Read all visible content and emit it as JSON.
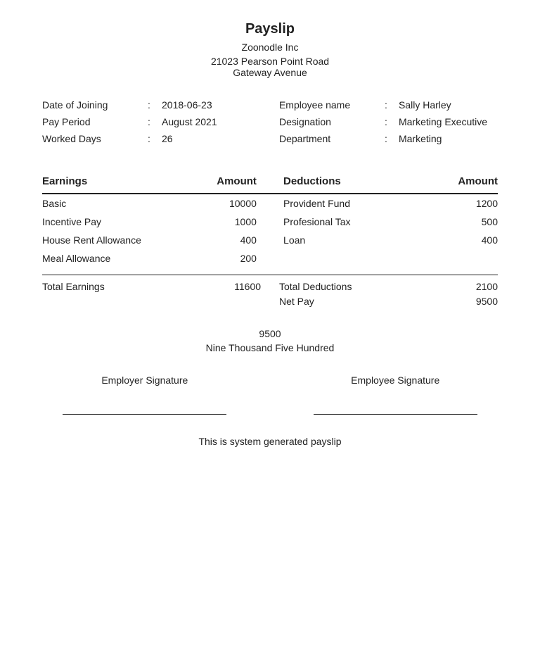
{
  "header": {
    "title": "Payslip",
    "company_name": "Zoonodle Inc",
    "address_line1": "21023 Pearson Point Road",
    "address_line2": "Gateway Avenue"
  },
  "info": {
    "left": {
      "date_of_joining_label": "Date of Joining",
      "date_of_joining_value": "2018-06-23",
      "pay_period_label": "Pay Period",
      "pay_period_value": "August 2021",
      "worked_days_label": "Worked Days",
      "worked_days_value": "26"
    },
    "right": {
      "employee_name_label": "Employee name",
      "employee_name_value": "Sally Harley",
      "designation_label": "Designation",
      "designation_value": "Marketing Executive",
      "department_label": "Department",
      "department_value": "Marketing"
    }
  },
  "earnings": {
    "header_label": "Earnings",
    "amount_label": "Amount",
    "items": [
      {
        "name": "Basic",
        "amount": "10000"
      },
      {
        "name": "Incentive Pay",
        "amount": "1000"
      },
      {
        "name": "House Rent Allowance",
        "amount": "400"
      },
      {
        "name": "Meal Allowance",
        "amount": "200"
      }
    ],
    "total_label": "Total Earnings",
    "total_value": "11600"
  },
  "deductions": {
    "header_label": "Deductions",
    "amount_label": "Amount",
    "items": [
      {
        "name": "Provident Fund",
        "amount": "1200"
      },
      {
        "name": "Profesional Tax",
        "amount": "500"
      },
      {
        "name": "Loan",
        "amount": "400"
      }
    ],
    "total_label": "Total Deductions",
    "total_value": "2100",
    "net_pay_label": "Net Pay",
    "net_pay_value": "9500"
  },
  "amount_words": {
    "number": "9500",
    "text": "Nine Thousand Five Hundred"
  },
  "signatures": {
    "employer_label": "Employer Signature",
    "employee_label": "Employee Signature"
  },
  "footer": {
    "note": "This is system generated payslip"
  }
}
